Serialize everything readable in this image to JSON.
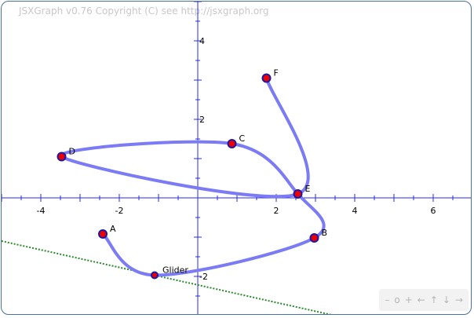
{
  "copyright": "JSXGraph v0.76 Copyright (C) see http://jsxgraph.org",
  "axes": {
    "x_ticks": [
      -4,
      -2,
      2,
      4,
      6
    ],
    "y_ticks": [
      4,
      2,
      -2
    ],
    "x_range": [
      -5,
      7
    ],
    "y_range": [
      -3,
      5
    ]
  },
  "colors": {
    "axis": "#2a2ae8",
    "curve": "#7b7bf5",
    "point_fill": "#ee0000",
    "point_stroke": "#1a1aa8",
    "tangent": "#2b8a2b",
    "border": "#4a6fa5"
  },
  "points": [
    {
      "label": "A",
      "x": -2.42,
      "y": -0.92
    },
    {
      "label": "B",
      "x": 2.97,
      "y": -1.02
    },
    {
      "label": "C",
      "x": 0.87,
      "y": 1.38
    },
    {
      "label": "D",
      "x": -3.47,
      "y": 1.05
    },
    {
      "label": "E",
      "x": 2.55,
      "y": 0.1
    },
    {
      "label": "F",
      "x": 1.75,
      "y": 3.05
    },
    {
      "label": "Glider",
      "x": -1.1,
      "y": -1.97
    }
  ],
  "curve_through": [
    "A",
    "Glider",
    "B",
    "E",
    "C",
    "D",
    "E",
    "F"
  ],
  "tangent_line": {
    "p1": [
      -5,
      -1.1
    ],
    "p2": [
      3.5,
      -3.0
    ]
  },
  "navigation": {
    "zoom_out": "–",
    "zoom_reset": "o",
    "zoom_in": "+",
    "left": "←",
    "up": "↑",
    "down": "↓",
    "right": "→"
  }
}
